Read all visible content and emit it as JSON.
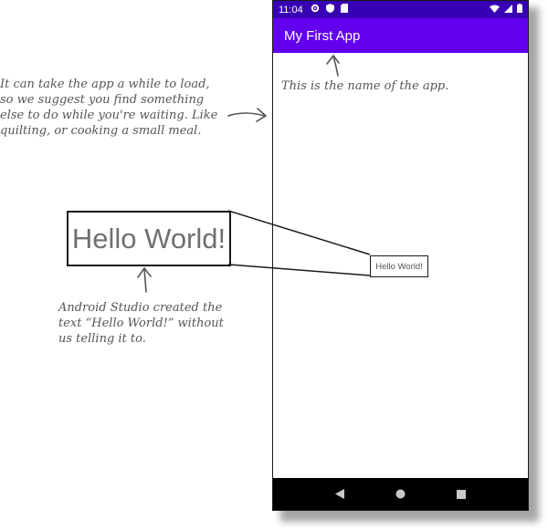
{
  "status_bar": {
    "time": "11:04"
  },
  "app_bar": {
    "title": "My First App"
  },
  "content": {
    "hello_text": "Hello World!"
  },
  "zoom": {
    "text": "Hello World!"
  },
  "annotations": {
    "load_note_lines": [
      "It can take the app a while to load,",
      "so we suggest you find something",
      "else to do while you're waiting. Like",
      "quilting, or cooking a small meal."
    ],
    "name_note": "This is the name of the app.",
    "hello_note_lines": [
      "Android Studio created the",
      "text “Hello World!” without",
      "us telling it to."
    ]
  },
  "icons": {
    "status_left": [
      "gear-icon",
      "shield-icon",
      "sd-card-icon"
    ],
    "status_right": [
      "wifi-icon",
      "signal-icon",
      "battery-icon"
    ],
    "nav": [
      "back-icon",
      "home-icon",
      "recents-icon"
    ]
  },
  "colors": {
    "status_bar": "#3700b3",
    "app_bar": "#6200ee",
    "nav_bar": "#000000"
  }
}
